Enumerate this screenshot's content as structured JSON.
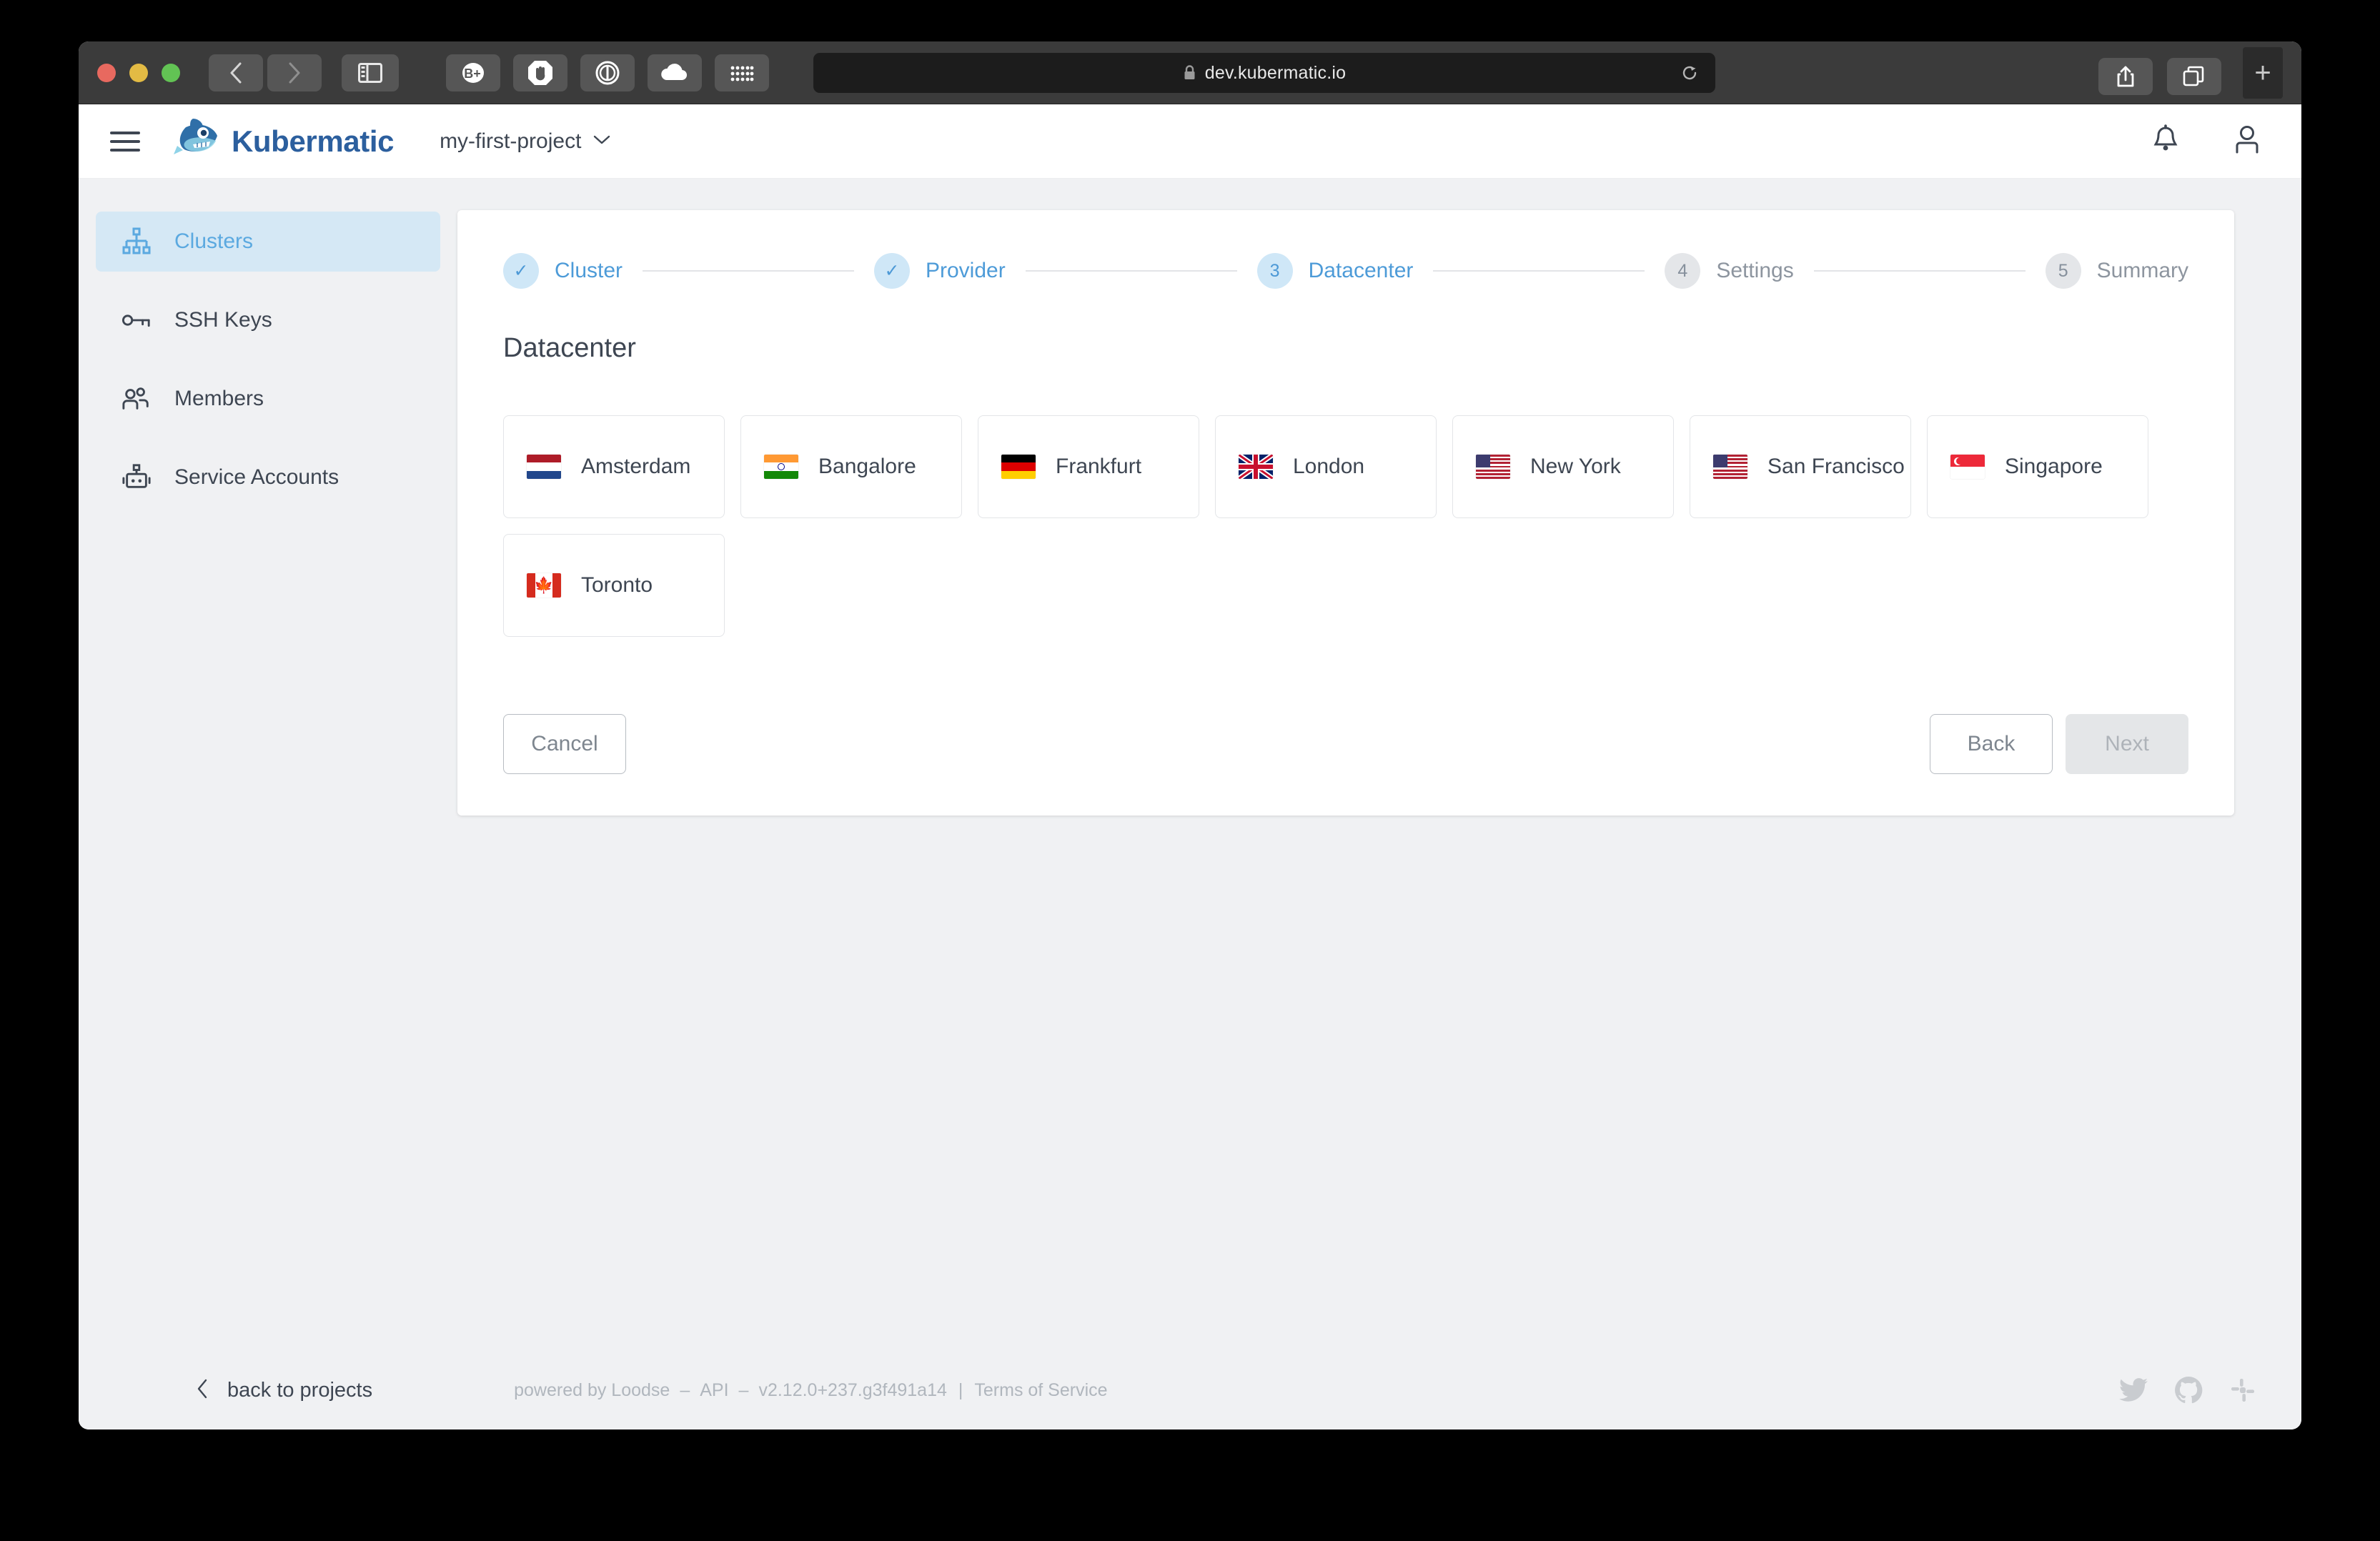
{
  "browser": {
    "url": "dev.kubermatic.io",
    "lock_icon": "lock-icon",
    "reload_icon": "reload-icon",
    "back_icon": "back-chevron-icon",
    "forward_icon": "forward-chevron-icon",
    "sidebar_icon": "sidebar-toggle-icon",
    "share_icon": "share-icon",
    "tabs_icon": "tab-overview-icon",
    "newtab_label": "+",
    "extensions": [
      {
        "name": "bitwarden-extension-icon",
        "glyph": "B+"
      },
      {
        "name": "adblock-extension-icon",
        "glyph": "hand"
      },
      {
        "name": "onepassword-extension-icon",
        "glyph": "circle-one"
      },
      {
        "name": "cloud-extension-icon",
        "glyph": "cloud"
      },
      {
        "name": "apps-grid-extension-icon",
        "glyph": "grid"
      }
    ]
  },
  "header": {
    "menu_icon": "hamburger-menu-icon",
    "brand": "Kubermatic",
    "logo_icon": "kubermatic-fish-logo",
    "project": "my-first-project",
    "project_chevron": "chevron-down-icon",
    "notifications_icon": "bell-icon",
    "account_icon": "user-account-icon"
  },
  "sidebar": {
    "items": [
      {
        "label": "Clusters",
        "icon": "clusters-hierarchy-icon",
        "active": true
      },
      {
        "label": "SSH Keys",
        "icon": "key-icon",
        "active": false
      },
      {
        "label": "Members",
        "icon": "members-people-icon",
        "active": false
      },
      {
        "label": "Service Accounts",
        "icon": "service-account-robot-icon",
        "active": false
      }
    ]
  },
  "wizard": {
    "steps": [
      {
        "number": "1",
        "label": "Cluster",
        "state": "done",
        "mark": "✓"
      },
      {
        "number": "2",
        "label": "Provider",
        "state": "done",
        "mark": "✓"
      },
      {
        "number": "3",
        "label": "Datacenter",
        "state": "current",
        "mark": "3"
      },
      {
        "number": "4",
        "label": "Settings",
        "state": "todo",
        "mark": "4"
      },
      {
        "number": "5",
        "label": "Summary",
        "state": "todo",
        "mark": "5"
      }
    ],
    "section_title": "Datacenter",
    "datacenters": [
      {
        "name": "Amsterdam",
        "flag": "nl",
        "flag_icon": "flag-netherlands-icon"
      },
      {
        "name": "Bangalore",
        "flag": "in",
        "flag_icon": "flag-india-icon"
      },
      {
        "name": "Frankfurt",
        "flag": "de",
        "flag_icon": "flag-germany-icon"
      },
      {
        "name": "London",
        "flag": "gb",
        "flag_icon": "flag-united-kingdom-icon"
      },
      {
        "name": "New York",
        "flag": "us",
        "flag_icon": "flag-united-states-icon"
      },
      {
        "name": "San Francisco",
        "flag": "us",
        "flag_icon": "flag-united-states-icon"
      },
      {
        "name": "Singapore",
        "flag": "sg",
        "flag_icon": "flag-singapore-icon"
      },
      {
        "name": "Toronto",
        "flag": "ca",
        "flag_icon": "flag-canada-icon"
      }
    ],
    "buttons": {
      "cancel": "Cancel",
      "back": "Back",
      "next": "Next",
      "next_disabled": true
    }
  },
  "footer": {
    "back_chevron": "chevron-left-icon",
    "back_label": "back to projects",
    "powered_by": "powered by Loodse",
    "sep1": "–",
    "api_label": "API",
    "sep2": "–",
    "version": "v2.12.0+237.g3f491a14",
    "divider": "|",
    "terms": "Terms of Service",
    "social": [
      {
        "name": "twitter-icon"
      },
      {
        "name": "github-icon"
      },
      {
        "name": "slack-icon"
      }
    ]
  },
  "colors": {
    "accent": "#4d9bd8",
    "active_bg": "#d5e8f5",
    "text": "#3e4652",
    "muted": "#b0b6bd",
    "page_bg": "#f0f1f3"
  }
}
